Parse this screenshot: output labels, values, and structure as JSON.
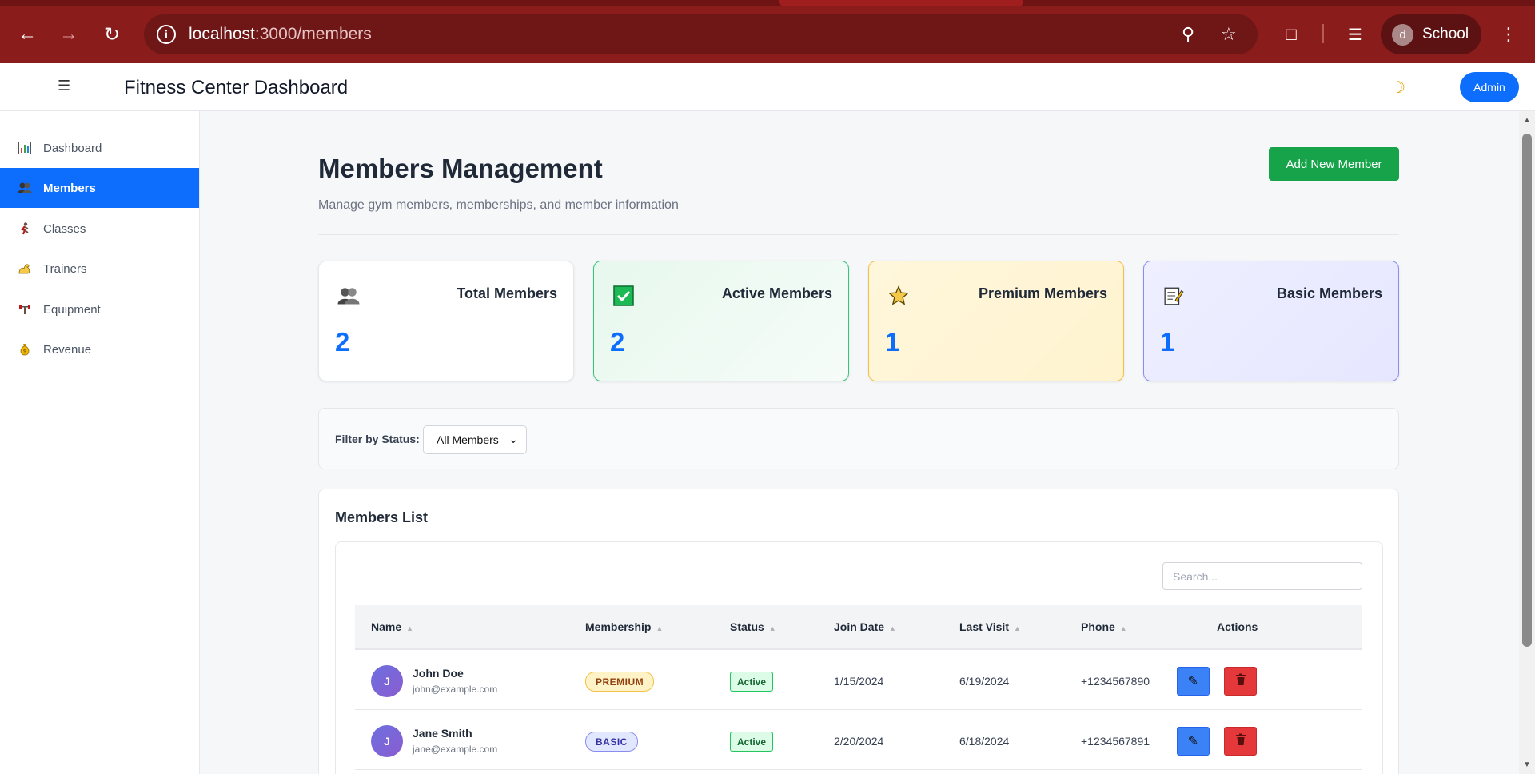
{
  "browser": {
    "url_host": "localhost",
    "url_path": ":3000/members",
    "profile_initial": "d",
    "profile_name": "School"
  },
  "header": {
    "title": "Fitness Center Dashboard",
    "admin_label": "Admin"
  },
  "sidebar": {
    "items": [
      {
        "label": "Dashboard",
        "icon": "chart-icon"
      },
      {
        "label": "Members",
        "icon": "members-icon"
      },
      {
        "label": "Classes",
        "icon": "runner-icon"
      },
      {
        "label": "Trainers",
        "icon": "muscle-icon"
      },
      {
        "label": "Equipment",
        "icon": "dumbbell-icon"
      },
      {
        "label": "Revenue",
        "icon": "money-bag-icon"
      }
    ],
    "active": "Members"
  },
  "page": {
    "title": "Members Management",
    "subtitle": "Manage gym members, memberships, and member information",
    "add_button": "Add New Member"
  },
  "stats": [
    {
      "label": "Total Members",
      "value": "2"
    },
    {
      "label": "Active Members",
      "value": "2"
    },
    {
      "label": "Premium Members",
      "value": "1"
    },
    {
      "label": "Basic Members",
      "value": "1"
    }
  ],
  "filter": {
    "label": "Filter by Status:",
    "selected": "All Members"
  },
  "list": {
    "title": "Members List",
    "search_placeholder": "Search...",
    "columns": [
      "Name",
      "Membership",
      "Status",
      "Join Date",
      "Last Visit",
      "Phone",
      "Actions"
    ],
    "rows": [
      {
        "initial": "J",
        "name": "John Doe",
        "email": "john@example.com",
        "membership": "PREMIUM",
        "status": "Active",
        "join_date": "1/15/2024",
        "last_visit": "6/19/2024",
        "phone": "+1234567890"
      },
      {
        "initial": "J",
        "name": "Jane Smith",
        "email": "jane@example.com",
        "membership": "BASIC",
        "status": "Active",
        "join_date": "2/20/2024",
        "last_visit": "6/18/2024",
        "phone": "+1234567891"
      }
    ]
  },
  "colors": {
    "browser_frame": "#8b1c1c",
    "primary": "#0d6efd",
    "success": "#16a34a",
    "danger": "#e5383b"
  }
}
